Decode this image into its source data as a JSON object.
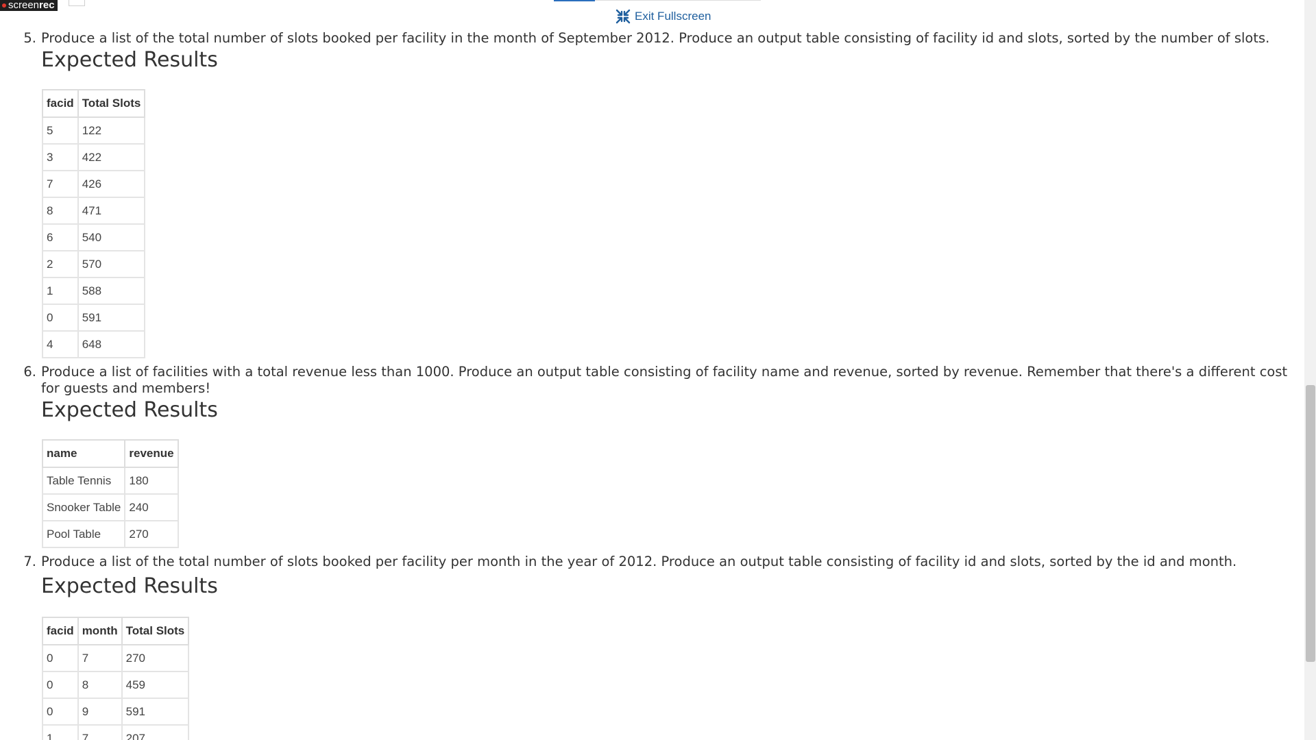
{
  "screenrec": {
    "light": "screen",
    "bold": "rec"
  },
  "toolbar": {
    "exit_fullscreen_label": "Exit Fullscreen"
  },
  "expected_label": "Expected Results",
  "questions": [
    {
      "number": "5.",
      "text": "Produce a list of the total number of slots booked per facility in the month of September 2012. Produce an output table consisting of facility id and slots, sorted by the number of slots.",
      "columns": [
        "facid",
        "Total Slots"
      ],
      "rows": [
        [
          "5",
          "122"
        ],
        [
          "3",
          "422"
        ],
        [
          "7",
          "426"
        ],
        [
          "8",
          "471"
        ],
        [
          "6",
          "540"
        ],
        [
          "2",
          "570"
        ],
        [
          "1",
          "588"
        ],
        [
          "0",
          "591"
        ],
        [
          "4",
          "648"
        ]
      ]
    },
    {
      "number": "6.",
      "text": "Produce a list of facilities with a total revenue less than 1000. Produce an output table consisting of facility name and revenue, sorted by revenue. Remember that there's a different cost for guests and members!",
      "columns": [
        "name",
        "revenue"
      ],
      "rows": [
        [
          "Table Tennis",
          "180"
        ],
        [
          "Snooker Table",
          "240"
        ],
        [
          "Pool Table",
          "270"
        ]
      ]
    },
    {
      "number": "7.",
      "text": "Produce a list of the total number of slots booked per facility per month in the year of 2012. Produce an output table consisting of facility id and slots, sorted by the id and month.",
      "columns": [
        "facid",
        "month",
        "Total Slots"
      ],
      "rows": [
        [
          "0",
          "7",
          "270"
        ],
        [
          "0",
          "8",
          "459"
        ],
        [
          "0",
          "9",
          "591"
        ],
        [
          "1",
          "7",
          "207"
        ]
      ]
    }
  ],
  "colors": {
    "link": "#1f5f9e",
    "text": "#333333",
    "table_border": "#dddddd"
  }
}
